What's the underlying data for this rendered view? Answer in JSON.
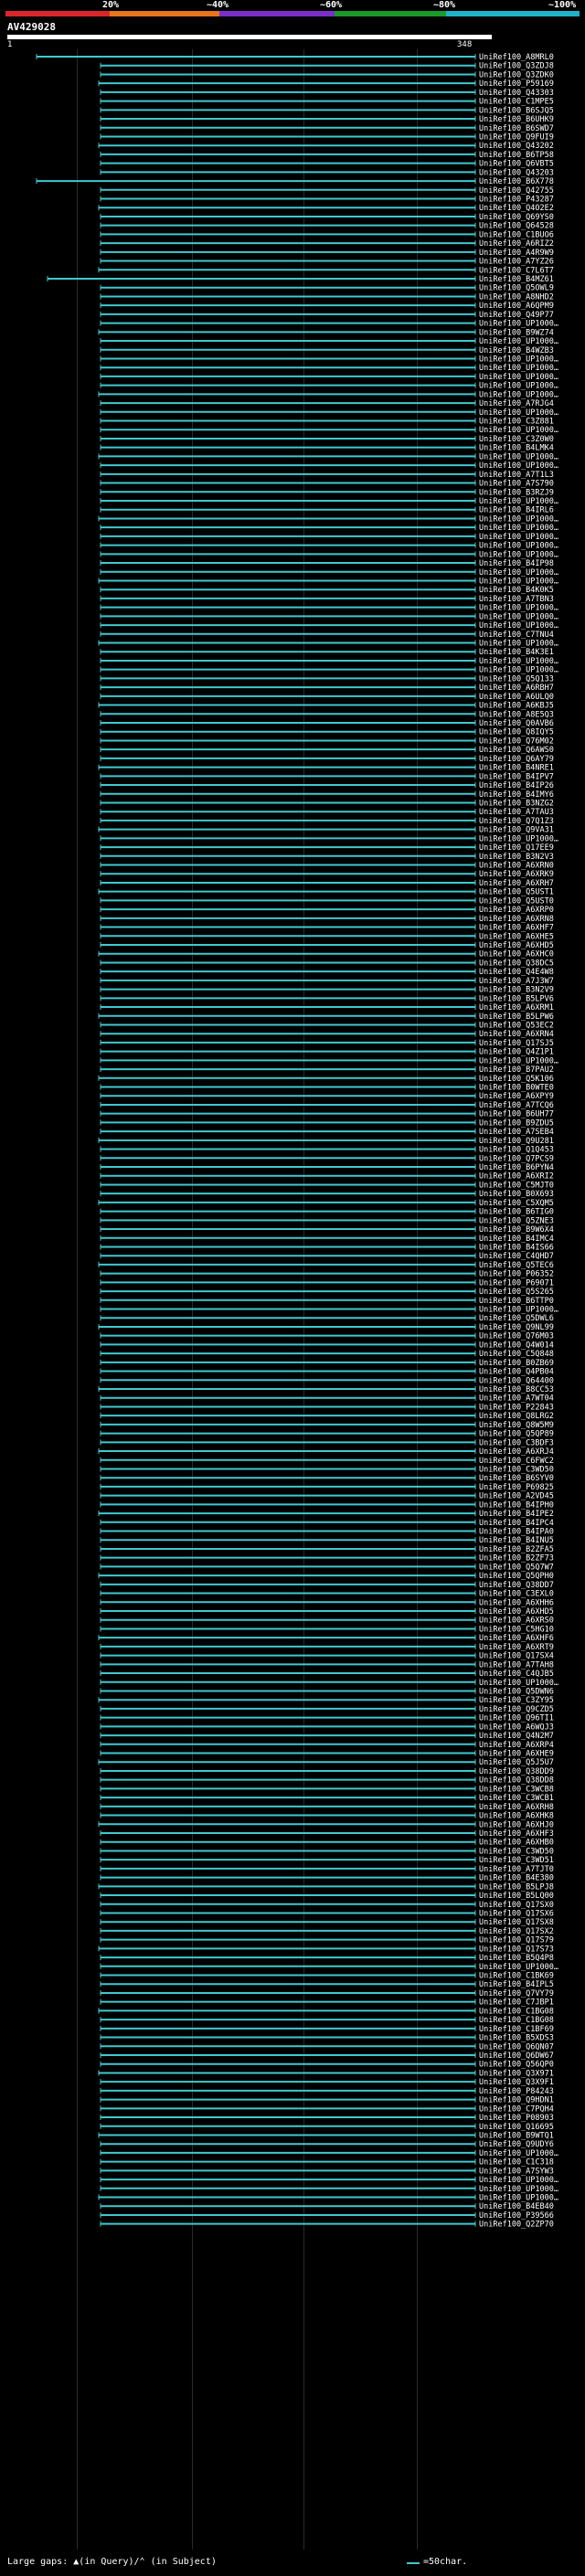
{
  "scale": {
    "labels": [
      "20%",
      "~40%",
      "~60%",
      "~80%",
      "~100%"
    ],
    "colors": [
      "#d9262c",
      "#e8741c",
      "#7b2ec9",
      "#1a9a2a",
      "#1fb2c9"
    ]
  },
  "query": {
    "id": "AV429028",
    "start": "1",
    "end": "348"
  },
  "hit_color": "#3fc9cf",
  "hits": [
    "UniRef100_A8MRL0",
    "UniRef100_Q3ZDJ8",
    "UniRef100_Q3ZDK0",
    "UniRef100_P59169",
    "UniRef100_Q43303",
    "UniRef100_C1MPE5",
    "UniRef100_B6SJQ5",
    "UniRef100_B6UHK9",
    "UniRef100_B6SWD7",
    "UniRef100_Q9FUI9",
    "UniRef100_Q43202",
    "UniRef100_B6TP58",
    "UniRef100_Q6VBT5",
    "UniRef100_Q43203",
    "UniRef100_B6X778",
    "UniRef100_Q42755",
    "UniRef100_P43287",
    "UniRef100_Q4O2E2",
    "UniRef100_Q69YS0",
    "UniRef100_Q64528",
    "UniRef100_C1BUO6",
    "UniRef100_A6RIZ2",
    "UniRef100_A4R9W9",
    "UniRef100_A7YZ26",
    "UniRef100_C7L6T7",
    "UniRef100_B4MZ61",
    "UniRef100_Q5OWL9",
    "UniRef100_A8NHD2",
    "UniRef100_A6QPM9",
    "UniRef100_Q49P77",
    "UniRef100_UP1000…",
    "UniRef100_B9WZ74",
    "UniRef100_UP1000…",
    "UniRef100_B4WZB3",
    "UniRef100_UP1000…",
    "UniRef100_UP1000…",
    "UniRef100_UP1000…",
    "UniRef100_UP1000…",
    "UniRef100_UP1000…",
    "UniRef100_A7RJG4",
    "UniRef100_UP1000…",
    "UniRef100_C3Z881",
    "UniRef100_UP1000…",
    "UniRef100_C3Z0W0",
    "UniRef100_B4LMK4",
    "UniRef100_UP1000…",
    "UniRef100_UP1000…",
    "UniRef100_A7T1L3",
    "UniRef100_A7S790",
    "UniRef100_B3RZJ9",
    "UniRef100_UP1000…",
    "UniRef100_B4IRL6",
    "UniRef100_UP1000…",
    "UniRef100_UP1000…",
    "UniRef100_UP1000…",
    "UniRef100_UP1000…",
    "UniRef100_UP1000…",
    "UniRef100_B4IP98",
    "UniRef100_UP1000…",
    "UniRef100_UP1000…",
    "UniRef100_B4K0K5",
    "UniRef100_A7TBN3",
    "UniRef100_UP1000…",
    "UniRef100_UP1000…",
    "UniRef100_UP1000…",
    "UniRef100_C7TNU4",
    "UniRef100_UP1000…",
    "UniRef100_B4K3E1",
    "UniRef100_UP1000…",
    "UniRef100_UP1000…",
    "UniRef100_Q5Q133",
    "UniRef100_A6RBH7",
    "UniRef100_A6ULQ0",
    "UniRef100_A6KBJ5",
    "UniRef100_A8E5Q3",
    "UniRef100_Q0AVB6",
    "UniRef100_Q8IQY5",
    "UniRef100_Q76M02",
    "UniRef100_Q6AWS0",
    "UniRef100_Q6AY79",
    "UniRef100_B4NRE1",
    "UniRef100_B4IPV7",
    "UniRef100_B4IP26",
    "UniRef100_B4IMY6",
    "UniRef100_B3NZG2",
    "UniRef100_A7TAU3",
    "UniRef100_Q7Q1Z3",
    "UniRef100_Q9VA31",
    "UniRef100_UP1000…",
    "UniRef100_Q17EE9",
    "UniRef100_B3N2V3",
    "UniRef100_A6XRN0",
    "UniRef100_A6XRK9",
    "UniRef100_A6XRH7",
    "UniRef100_Q5UST1",
    "UniRef100_Q5UST0",
    "UniRef100_A6XRP0",
    "UniRef100_A6XRN8",
    "UniRef100_A6XHF7",
    "UniRef100_A6XHE5",
    "UniRef100_A6XHD5",
    "UniRef100_A6XHC0",
    "UniRef100_Q38DC5",
    "UniRef100_Q4E4W8",
    "UniRef100_A7J3W7",
    "UniRef100_B3N2V9",
    "UniRef100_B5LPV6",
    "UniRef100_A6XRM1",
    "UniRef100_B5LPW6",
    "UniRef100_Q53EC2",
    "UniRef100_A6XRN4",
    "UniRef100_Q17SJ5",
    "UniRef100_Q4Z1P1",
    "UniRef100_UP1000…",
    "UniRef100_B7PAU2",
    "UniRef100_Q5K106",
    "UniRef100_B0WTE0",
    "UniRef100_A6XPY9",
    "UniRef100_A7TCQ6",
    "UniRef100_B6UH77",
    "UniRef100_B9ZDU5",
    "UniRef100_A7SEB4",
    "UniRef100_Q9U281",
    "UniRef100_Q1Q453",
    "UniRef100_Q7PCS9",
    "UniRef100_B6PYN4",
    "UniRef100_A6XRI2",
    "UniRef100_C5MJT0",
    "UniRef100_B0X693",
    "UniRef100_C5XQM5",
    "UniRef100_B6TIG0",
    "UniRef100_Q5ZNE3",
    "UniRef100_B9W6X4",
    "UniRef100_B4IMC4",
    "UniRef100_B4IS66",
    "UniRef100_C4QHD7",
    "UniRef100_Q5TEC6",
    "UniRef100_P06352",
    "UniRef100_P69071",
    "UniRef100_Q5S265",
    "UniRef100_B6TTP0",
    "UniRef100_UP1000…",
    "UniRef100_Q5DWL6",
    "UniRef100_Q9NL99",
    "UniRef100_Q76M03",
    "UniRef100_Q4W014",
    "UniRef100_C5Q848",
    "UniRef100_B0ZB69",
    "UniRef100_Q4PB04",
    "UniRef100_Q64400",
    "UniRef100_B8CC53",
    "UniRef100_A7WT04",
    "UniRef100_P22843",
    "UniRef100_Q8LRG2",
    "UniRef100_Q8W5M9",
    "UniRef100_Q5QP89",
    "UniRef100_C3BDF3",
    "UniRef100_A6XRJ4",
    "UniRef100_C6FWC2",
    "UniRef100_C3WD50",
    "UniRef100_B6SYV0",
    "UniRef100_P69825",
    "UniRef100_A2VD45",
    "UniRef100_B4IPH0",
    "UniRef100_B4IPE2",
    "UniRef100_B4IPC4",
    "UniRef100_B4IPA0",
    "UniRef100_B4INU5",
    "UniRef100_B2ZFA5",
    "UniRef100_B2ZF73",
    "UniRef100_Q5Q7W7",
    "UniRef100_Q5QPH0",
    "UniRef100_Q38DD7",
    "UniRef100_C3EXL0",
    "UniRef100_A6XHH6",
    "UniRef100_A6XHD5",
    "UniRef100_A6XRS0",
    "UniRef100_C5HG10",
    "UniRef100_A6XHF6",
    "UniRef100_A6XRT9",
    "UniRef100_Q17SX4",
    "UniRef100_A7TAH8",
    "UniRef100_C4QJB5",
    "UniRef100_UP1000…",
    "UniRef100_Q5DWN6",
    "UniRef100_C3ZY95",
    "UniRef100_Q9CZD5",
    "UniRef100_Q96TI1",
    "UniRef100_A6WQJ3",
    "UniRef100_Q4N2M7",
    "UniRef100_A6XRP4",
    "UniRef100_A6XHE9",
    "UniRef100_Q5J5U7",
    "UniRef100_Q38DD9",
    "UniRef100_Q38DD8",
    "UniRef100_C3WCB8",
    "UniRef100_C3WCB1",
    "UniRef100_A6XRH8",
    "UniRef100_A6XHK8",
    "UniRef100_A6XHJ0",
    "UniRef100_A6XHF3",
    "UniRef100_A6XHB0",
    "UniRef100_C3WD50",
    "UniRef100_C3WD51",
    "UniRef100_A7TJT0",
    "UniRef100_B4E380",
    "UniRef100_B5LPJ8",
    "UniRef100_B5LQ00",
    "UniRef100_Q17SX0",
    "UniRef100_Q17SX6",
    "UniRef100_Q17SX8",
    "UniRef100_Q17SX2",
    "UniRef100_Q17S79",
    "UniRef100_Q17S73",
    "UniRef100_B5Q4P8",
    "UniRef100_UP1000…",
    "UniRef100_C1BK69",
    "UniRef100_B4IPL5",
    "UniRef100_Q7VY79",
    "UniRef100_C7JBP1",
    "UniRef100_C1BG08",
    "UniRef100_C1BG08",
    "UniRef100_C1BF69",
    "UniRef100_B5XDS3",
    "UniRef100_Q6QN07",
    "UniRef100_Q6DW67",
    "UniRef100_Q56QP0",
    "UniRef100_Q3X971",
    "UniRef100_Q3X9F1",
    "UniRef100_P84243",
    "UniRef100_Q9HDN1",
    "UniRef100_C7PQH4",
    "UniRef100_P08903",
    "UniRef100_Q16695",
    "UniRef100_B9WTQ1",
    "UniRef100_Q9UDY6",
    "UniRef100_UP1000…",
    "UniRef100_C1C318",
    "UniRef100_A7SYW3",
    "UniRef100_UP1000…",
    "UniRef100_UP1000…",
    "UniRef100_UP1000…",
    "UniRef100_B4EB40",
    "UniRef100_P39566",
    "UniRef100_Q2ZP70"
  ],
  "legend": {
    "large_gaps": "Large gaps:",
    "in_query": "(in Query)",
    "in_subject": "(in Subject)",
    "scale_note": "=50char."
  }
}
